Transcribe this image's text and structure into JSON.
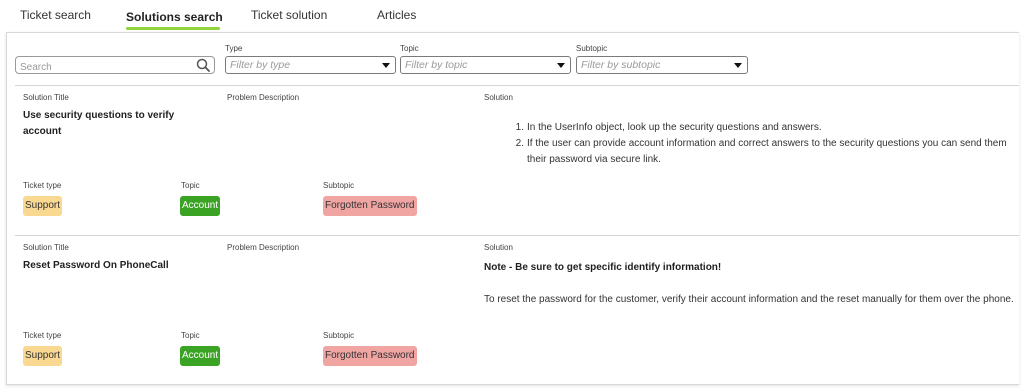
{
  "tabs": [
    {
      "label": "Ticket search"
    },
    {
      "label": "Solutions search"
    },
    {
      "label": "Ticket solution"
    },
    {
      "label": "Articles"
    }
  ],
  "filters": {
    "search_placeholder": "Search",
    "type_label": "Type",
    "type_placeholder": "Filter by type",
    "topic_label": "Topic",
    "topic_placeholder": "Filter by topic",
    "subtopic_label": "Subtopic",
    "subtopic_placeholder": "Filter by subtopic"
  },
  "labels": {
    "solution_title": "Solution Title",
    "problem_description": "Problem Description",
    "solution": "Solution",
    "ticket_type": "Ticket type",
    "topic": "Topic",
    "subtopic": "Subtopic"
  },
  "solutions": [
    {
      "title": "Use security questions to verify account",
      "steps": [
        {
          "num": "1.",
          "text": "In the UserInfo object, look up the security questions and answers."
        },
        {
          "num": "2.",
          "text": "If the user can provide account information and correct answers to the security questions you can send them their password via secure link."
        }
      ],
      "ticket_type": "Support",
      "topic": "Account",
      "subtopic": "Forgotten Password"
    },
    {
      "title": "Reset Password On PhoneCall",
      "note": "Note - Be sure to get specific identify information!",
      "text": "To reset the password for the customer, verify their account information and the reset manually for them over the phone.",
      "ticket_type": "Support",
      "topic": "Account",
      "subtopic": "Forgotten Password"
    }
  ],
  "colors": {
    "tab_accent": "#8fd43a",
    "support_badge": "#f9d892",
    "account_badge": "#3aa324",
    "subtopic_badge": "#f1a5a3"
  },
  "icons": {
    "search": "search-icon",
    "dropdown": "caret-down-icon"
  }
}
